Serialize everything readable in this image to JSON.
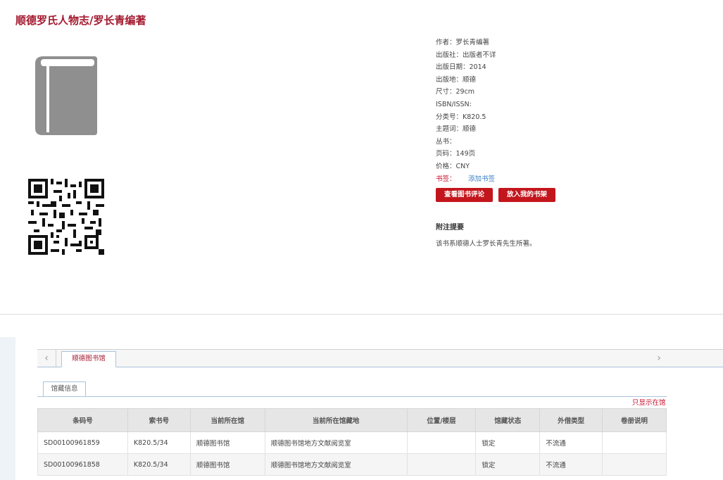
{
  "header": {
    "title": "顺德罗氏人物志/罗长青编著"
  },
  "icons": {
    "book": "book-icon",
    "qr": "qr-code-icon"
  },
  "meta": [
    "作者：罗长青编著",
    "出版社：出版者不详",
    "出版日期：2014",
    "出版地：顺德",
    "尺寸：29cm",
    "ISBN/ISSN:",
    "分类号：K820.5",
    "主题词：顺德",
    "丛书：",
    "页码：149页",
    "价格：CNY"
  ],
  "bookmark": {
    "label": "书签：",
    "link": "添加书签"
  },
  "buttons": {
    "review": "查看图书评论",
    "shelf": "放入我的书架"
  },
  "notes": {
    "title": "附注提要",
    "body": "该书系顺德人士罗长青先生所著。"
  },
  "tabs": {
    "library": "顺德图书馆",
    "holdings": "馆藏信息",
    "left_arrow": "‹",
    "right_arrow": "›"
  },
  "show_link": "只显示在馆",
  "table": {
    "headers": [
      "条码号",
      "索书号",
      "当前所在馆",
      "当前所在馆藏地",
      "位置/楼层",
      "馆藏状态",
      "外借类型",
      "卷册说明"
    ],
    "rows": [
      [
        "SD00100961859",
        "K820.5/34",
        "顺德图书馆",
        "顺德图书馆地方文献阅览室",
        "",
        "锁定",
        "不流通",
        ""
      ],
      [
        "SD00100961858",
        "K820.5/34",
        "顺德图书馆",
        "顺德图书馆地方文献阅览室",
        "",
        "锁定",
        "不流通",
        ""
      ]
    ]
  },
  "colors": {
    "accent": "#a3192e",
    "button": "#c3161c",
    "link": "#3b7fc4"
  }
}
